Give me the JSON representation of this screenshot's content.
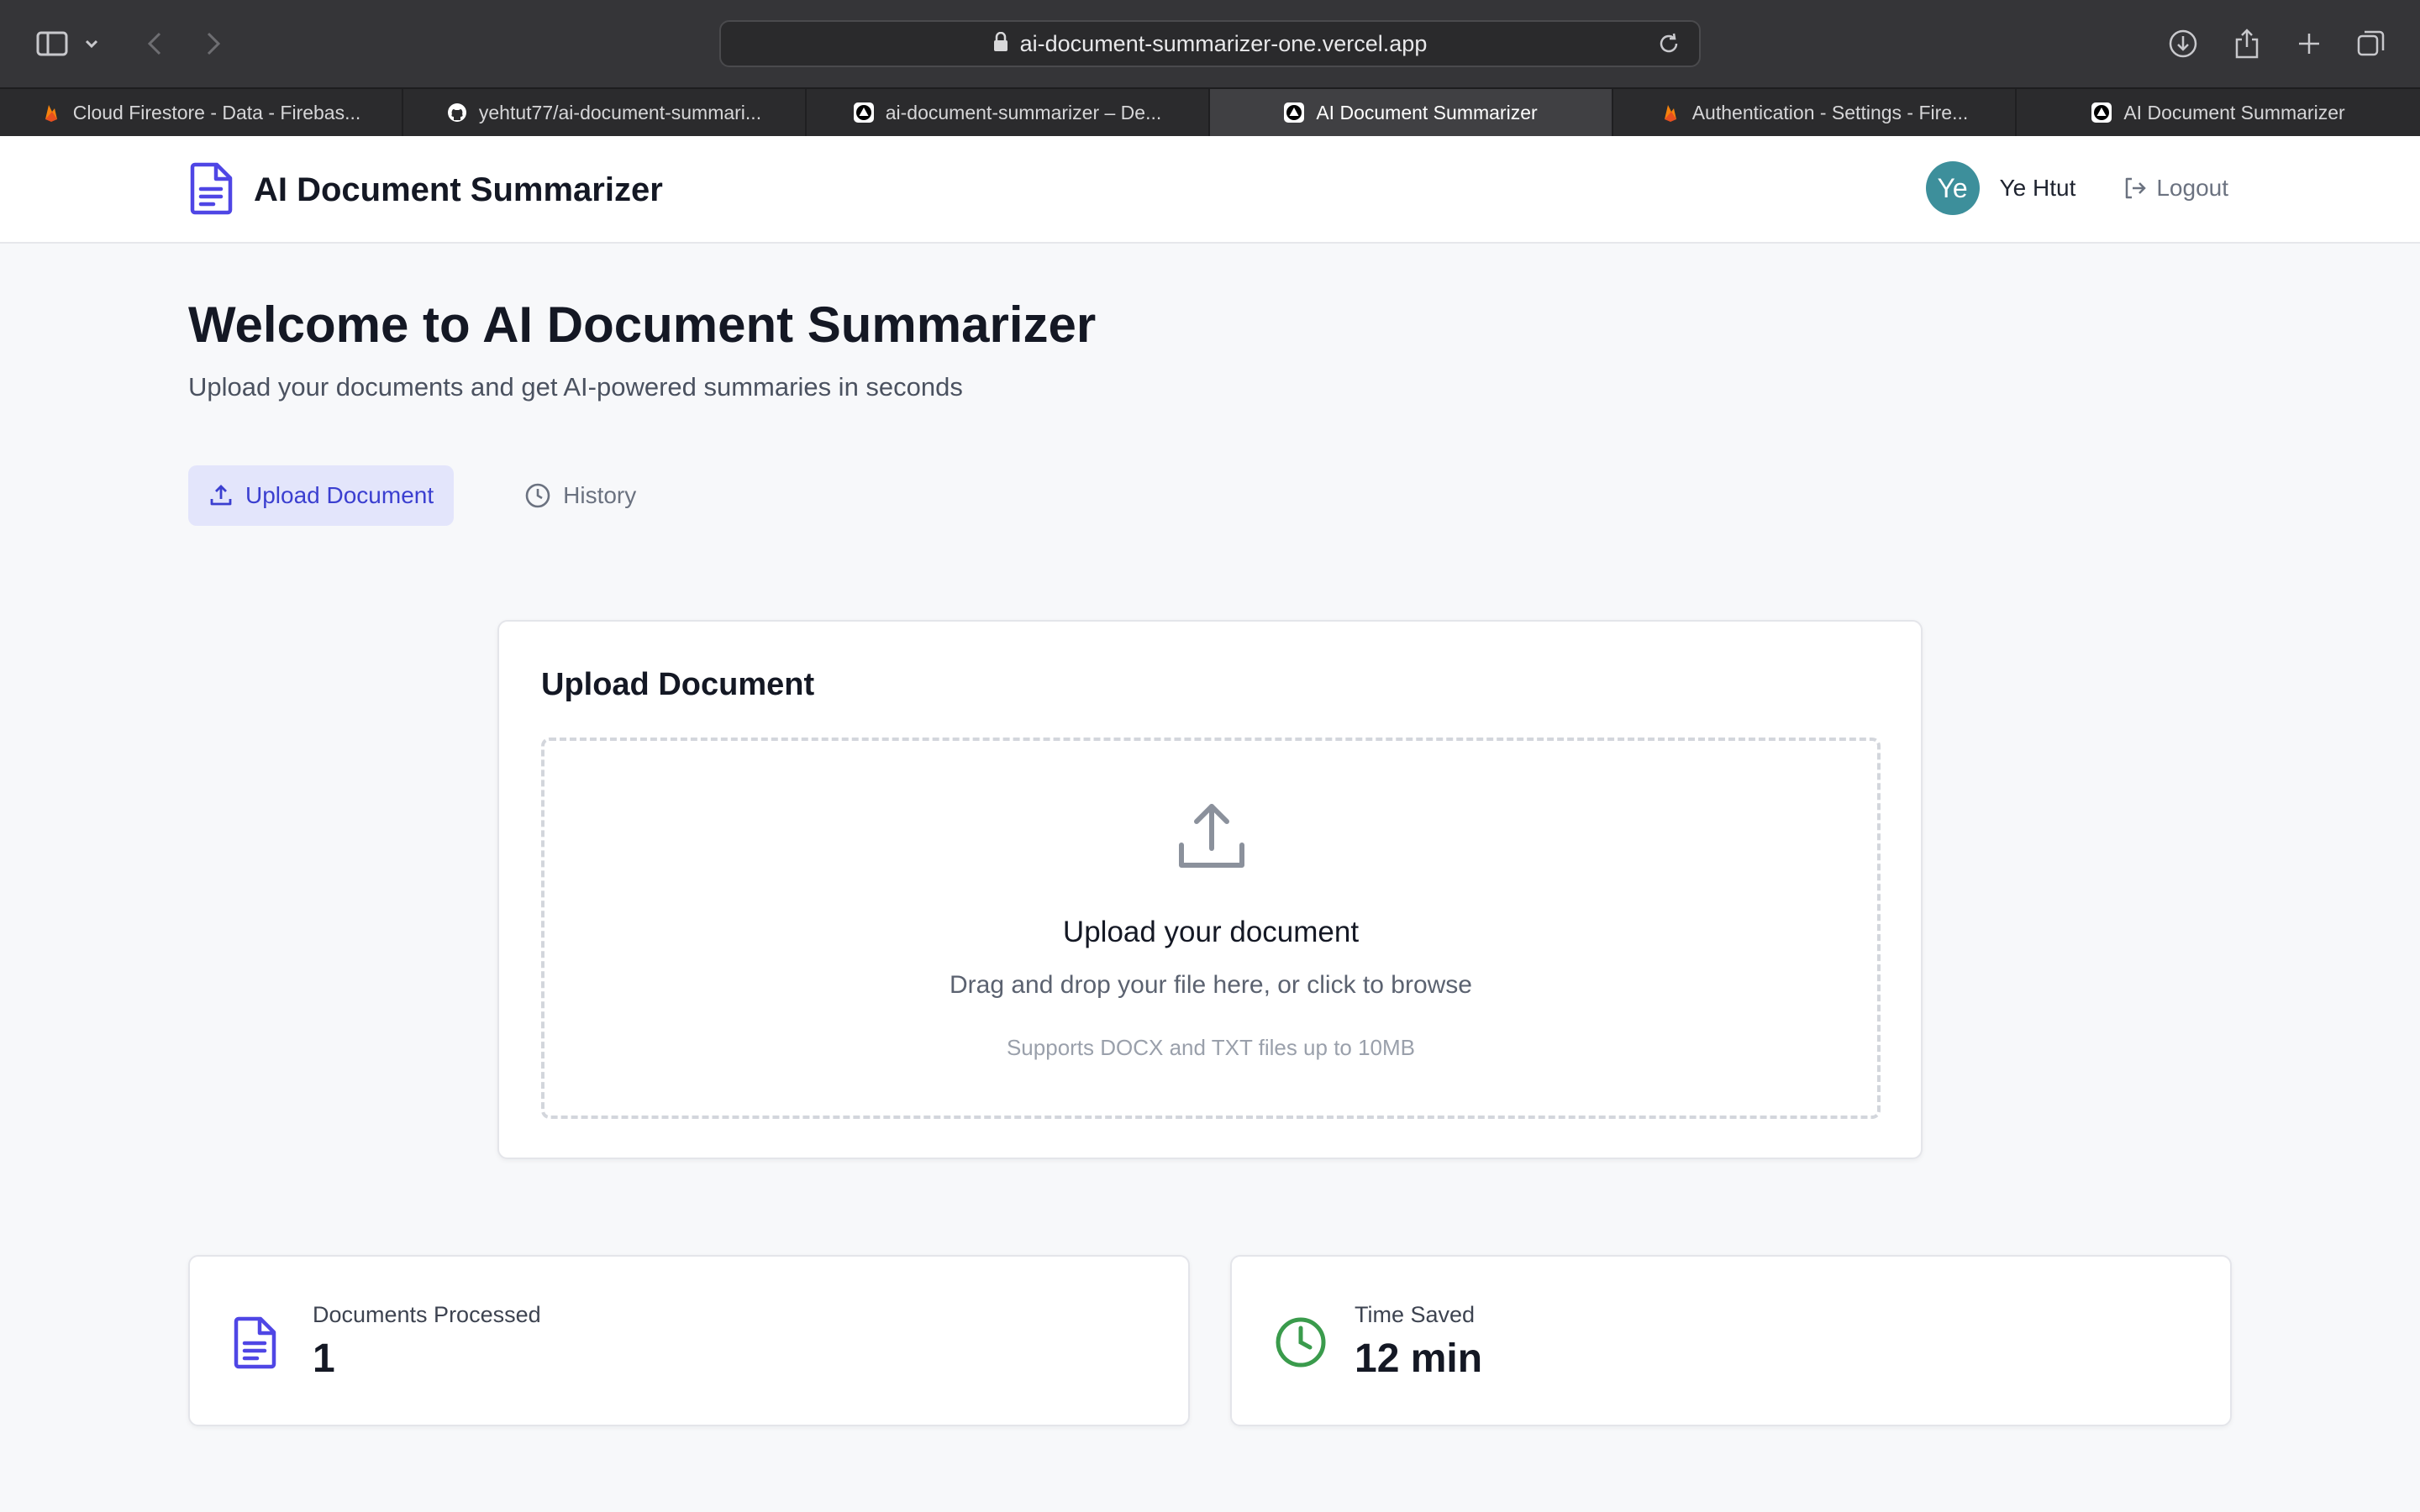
{
  "browser": {
    "url": "ai-document-summarizer-one.vercel.app",
    "tabs": [
      {
        "label": "Cloud Firestore - Data - Firebas...",
        "icon": "firebase-icon",
        "active": false
      },
      {
        "label": "yehtut77/ai-document-summari...",
        "icon": "github-icon",
        "active": false
      },
      {
        "label": "ai-document-summarizer – De...",
        "icon": "vercel-icon",
        "active": false
      },
      {
        "label": "AI Document Summarizer",
        "icon": "vercel-icon",
        "active": true
      },
      {
        "label": "Authentication - Settings - Fire...",
        "icon": "firebase-icon",
        "active": false
      },
      {
        "label": "AI Document Summarizer",
        "icon": "vercel-icon",
        "active": false
      }
    ]
  },
  "header": {
    "title": "AI Document Summarizer",
    "avatar_initials": "Ye",
    "user_name": "Ye Htut",
    "logout_label": "Logout"
  },
  "welcome": {
    "heading": "Welcome to AI Document Summarizer",
    "subheading": "Upload your documents and get AI-powered summaries in seconds"
  },
  "nav": {
    "upload_label": "Upload Document",
    "history_label": "History"
  },
  "upload": {
    "card_title": "Upload Document",
    "drop_title": "Upload your document",
    "drop_hint": "Drag and drop your file here, or click to browse",
    "drop_support": "Supports DOCX and TXT files up to 10MB"
  },
  "stats": {
    "documents": {
      "label": "Documents Processed",
      "value": "1"
    },
    "time": {
      "label": "Time Saved",
      "value": "12 min"
    }
  },
  "colors": {
    "accent": "#4f46e5",
    "success": "#3a9b4c",
    "avatar": "#3d8f9b"
  }
}
